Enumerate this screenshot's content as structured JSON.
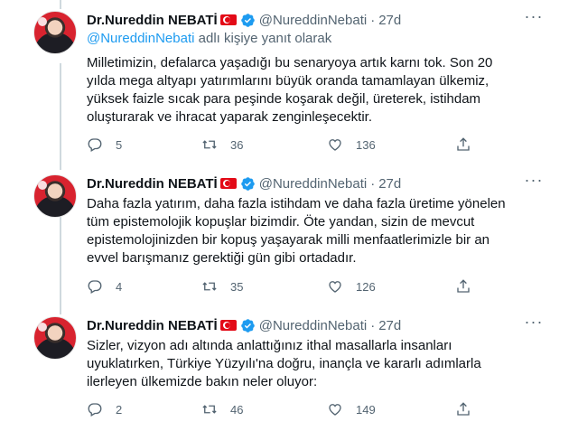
{
  "tweets": [
    {
      "author_name": "Dr.Nureddin NEBATİ",
      "handle": "@NureddinNebati",
      "separator": "·",
      "time": "27d",
      "reply_mention": "@NureddinNebati",
      "reply_suffix": " adlı kişiye yanıt olarak",
      "text": "Milletimizin, defalarca yaşadığı bu senaryoya artık karnı tok. Son 20 yılda mega altyapı yatırımlarını büyük oranda tamamlayan ülkemiz, yüksek faizle sıcak para peşinde koşarak değil, üreterek, istihdam oluşturarak ve ihracat yaparak zenginleşecektir.",
      "replies": "5",
      "retweets": "36",
      "likes": "136"
    },
    {
      "author_name": "Dr.Nureddin NEBATİ",
      "handle": "@NureddinNebati",
      "separator": "·",
      "time": "27d",
      "text": "Daha fazla yatırım, daha fazla istihdam ve daha fazla üretime yönelen tüm epistemolojik kopuşlar bizimdir. Öte yandan, sizin de mevcut epistemolojinizden bir kopuş yaşayarak milli menfaatlerimizle bir an evvel barışmanız gerektiği gün gibi ortadadır.",
      "replies": "4",
      "retweets": "35",
      "likes": "126"
    },
    {
      "author_name": "Dr.Nureddin NEBATİ",
      "handle": "@NureddinNebati",
      "separator": "·",
      "time": "27d",
      "text": "Sizler, vizyon adı altında anlattığınız ithal masallarla insanları uyuklatırken, Türkiye Yüzyılı'na doğru, inançla ve kararlı adımlarla ilerleyen ülkemizde bakın neler oluyor:",
      "replies": "2",
      "retweets": "46",
      "likes": "149"
    }
  ],
  "icons": {
    "more": "more-icon",
    "verified": "verified-badge-icon",
    "flag": "turkey-flag-icon",
    "reply": "reply-icon",
    "retweet": "retweet-icon",
    "like": "like-icon",
    "share": "share-icon"
  },
  "colors": {
    "accent": "#1d9bf0",
    "muted": "#536471",
    "text": "#0f1419",
    "thread_line": "#cfd9de",
    "flag_red": "#e30a17"
  }
}
